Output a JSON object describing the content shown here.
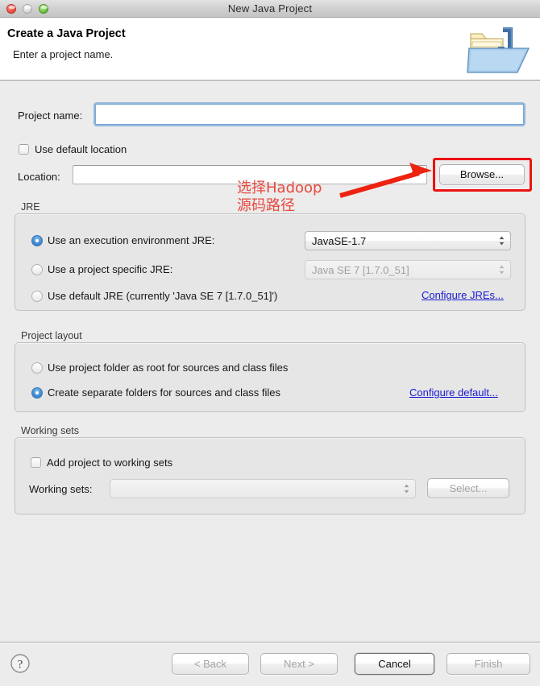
{
  "window": {
    "title": "New Java Project",
    "traffic_lights": [
      "close-button",
      "minimize-button",
      "zoom-button"
    ]
  },
  "header": {
    "title": "Create a Java Project",
    "subtitle": "Enter a project name.",
    "icon": "java-project-folder-icon"
  },
  "form": {
    "project_name_label": "Project name:",
    "project_name_value": "",
    "use_default_location_label": "Use default location",
    "use_default_location_checked": false,
    "location_label": "Location:",
    "location_value": "",
    "browse_button": "Browse..."
  },
  "jre": {
    "group_title": "JRE",
    "options": [
      {
        "label": "Use an execution environment JRE:",
        "selected": true
      },
      {
        "label": "Use a project specific JRE:",
        "selected": false
      },
      {
        "label": "Use default JRE (currently 'Java SE 7 [1.7.0_51]')",
        "selected": false
      }
    ],
    "execution_env_value": "JavaSE-1.7",
    "project_jre_value": "Java SE 7 [1.7.0_51]",
    "configure_link": "Configure JREs..."
  },
  "project_layout": {
    "group_title": "Project layout",
    "options": [
      {
        "label": "Use project folder as root for sources and class files",
        "selected": false
      },
      {
        "label": "Create separate folders for sources and class files",
        "selected": true
      }
    ],
    "configure_link": "Configure default..."
  },
  "working_sets": {
    "group_title": "Working sets",
    "add_checkbox_label": "Add project to working sets",
    "add_checkbox_checked": false,
    "working_sets_label": "Working sets:",
    "working_sets_value": "",
    "select_button": "Select..."
  },
  "footer": {
    "help_icon": "help-question-icon",
    "buttons": [
      {
        "label": "< Back",
        "state": "disabled"
      },
      {
        "label": "Next >",
        "state": "disabled"
      },
      {
        "label": "Cancel",
        "state": "default"
      },
      {
        "label": "Finish",
        "state": "disabled"
      }
    ]
  },
  "annotation": {
    "text": "选择Hadoop\n源码路径",
    "color": "#e8493f",
    "highlight_color": "#ee1111",
    "highlight_target": "browse-button"
  }
}
